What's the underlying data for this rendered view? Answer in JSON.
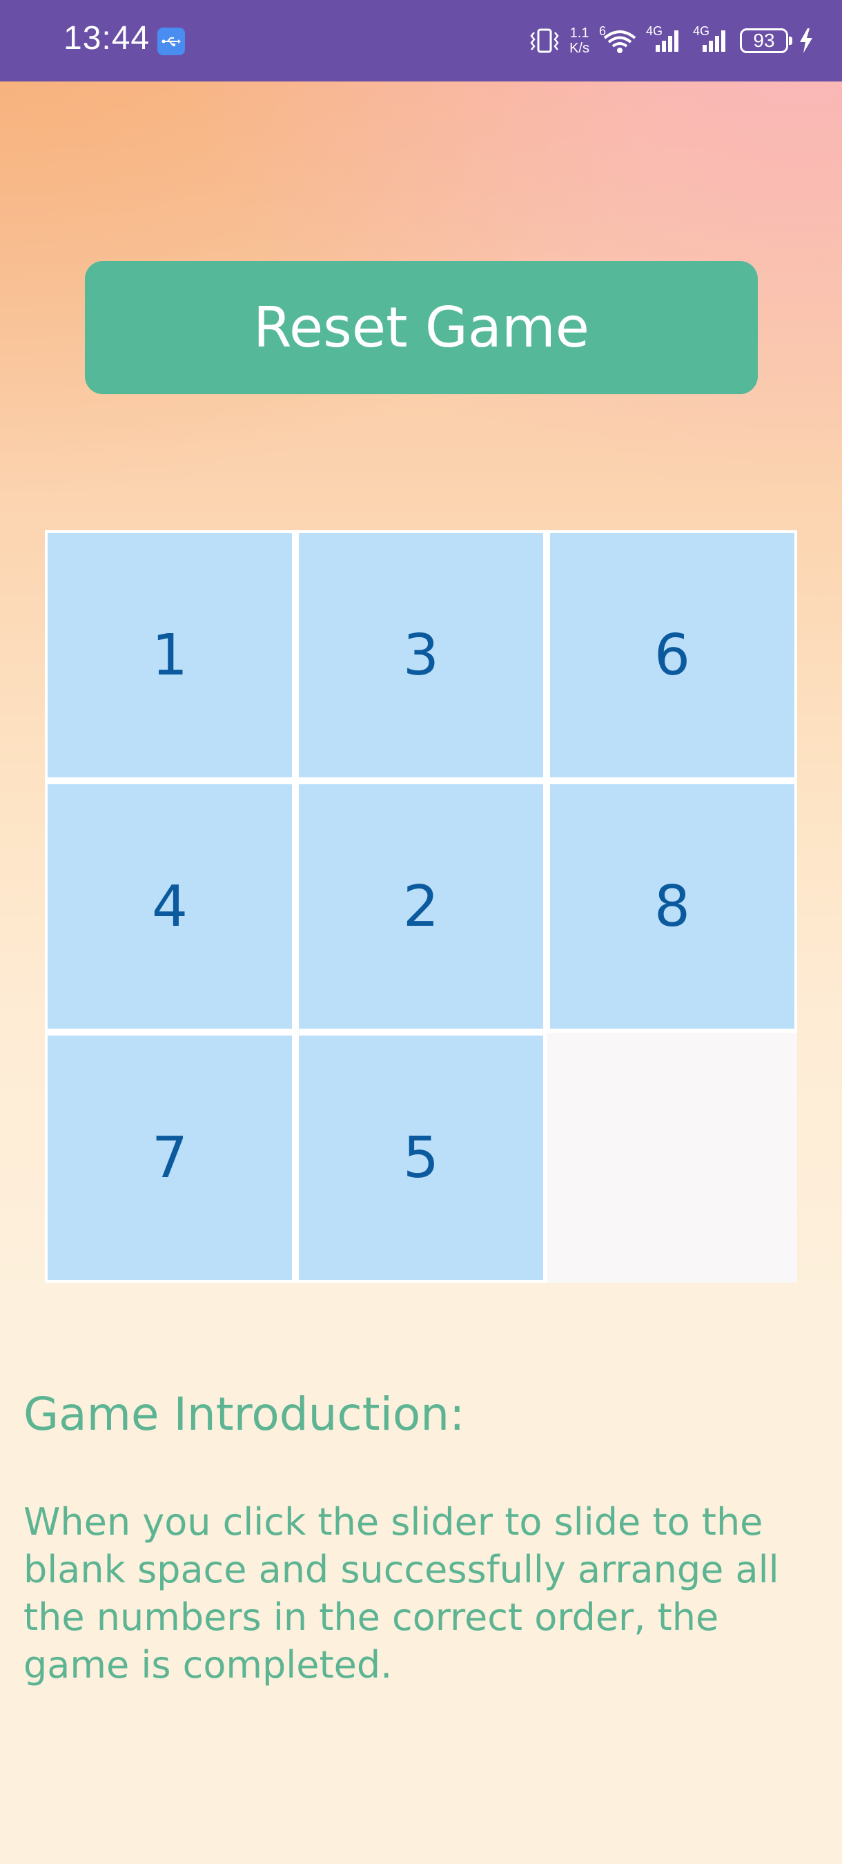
{
  "status_bar": {
    "time": "13:44",
    "net_speed_top": "1.1",
    "net_speed_bottom": "K/s",
    "wifi_label": "6",
    "signal1_label": "4G",
    "signal2_label": "4G",
    "battery_level": "93",
    "icons": [
      "usb-icon",
      "vibrate-icon",
      "wifi-icon",
      "signal-icon",
      "signal-icon",
      "battery-icon",
      "charging-icon"
    ]
  },
  "game": {
    "reset_label": "Reset Game",
    "tiles": [
      "1",
      "3",
      "6",
      "4",
      "2",
      "8",
      "7",
      "5",
      ""
    ]
  },
  "intro": {
    "title": "Game Introduction:",
    "text": "When you click the slider to slide to the blank space and successfully arrange all the numbers in the correct order, the game is completed."
  },
  "colors": {
    "status_bar": "#6a4fa6",
    "button": "#55b898",
    "tile": "#bbdef9",
    "tile_text": "#0b5a9e",
    "blank_tile": "#f9f7f7",
    "intro_text": "#5cb493"
  }
}
